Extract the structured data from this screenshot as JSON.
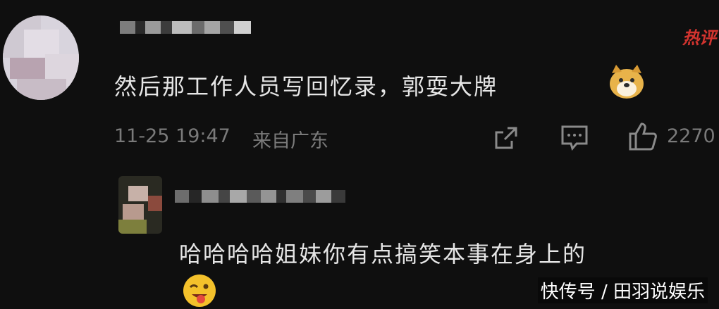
{
  "first_comment": {
    "text": "然后那工作人员写回忆录，郭耍大牌",
    "timestamp": "11-25 19:47",
    "location": "来自广东",
    "likes": "2270",
    "hot_badge": "热评",
    "emoji": "dog-face-emoji"
  },
  "reply": {
    "text": "哈哈哈哈姐妹你有点搞笑本事在身上的",
    "emoji": "winking-tongue-emoji"
  },
  "watermark": "快传号 / 田羽说娱乐",
  "actions": {
    "share_icon": "share-icon",
    "comment_icon": "comment-icon",
    "like_icon": "thumbs-up-icon"
  }
}
